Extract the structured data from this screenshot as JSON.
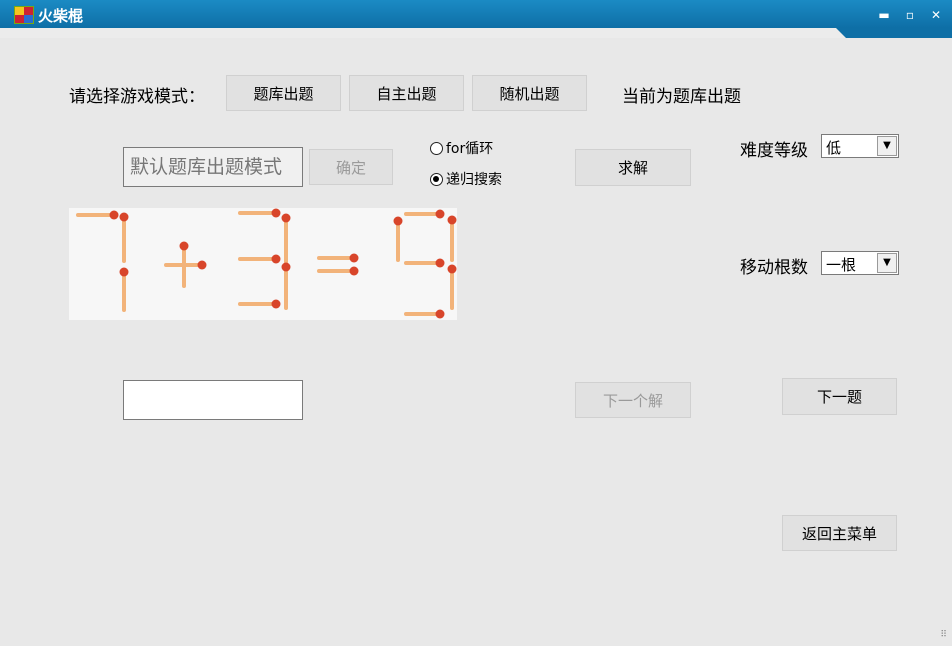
{
  "window": {
    "title": "火柴棍"
  },
  "mode_label": "请选择游戏模式：",
  "mode_buttons": {
    "bank": "题库出题",
    "custom": "自主出题",
    "random": "随机出题"
  },
  "current_mode": "当前为题库出题",
  "equation_input": {
    "value": "默认题库出题模式"
  },
  "confirm_button": "确定",
  "algorithm": {
    "options": [
      {
        "label": "for循环",
        "checked": false
      },
      {
        "label": "递归搜索",
        "checked": true
      }
    ]
  },
  "solve_button": "求解",
  "difficulty": {
    "label": "难度等级",
    "value": "低"
  },
  "moves": {
    "label": "移动根数",
    "value": "一根"
  },
  "puzzle": {
    "equation": "7+3=9"
  },
  "answer_input": {
    "value": ""
  },
  "next_solution_button": "下一个解",
  "next_question_button": "下一题",
  "back_button": "返回主菜单",
  "colors": {
    "titlebar": "#1682bf",
    "match_stick": "#f2b37a",
    "match_head": "#d8452a"
  }
}
